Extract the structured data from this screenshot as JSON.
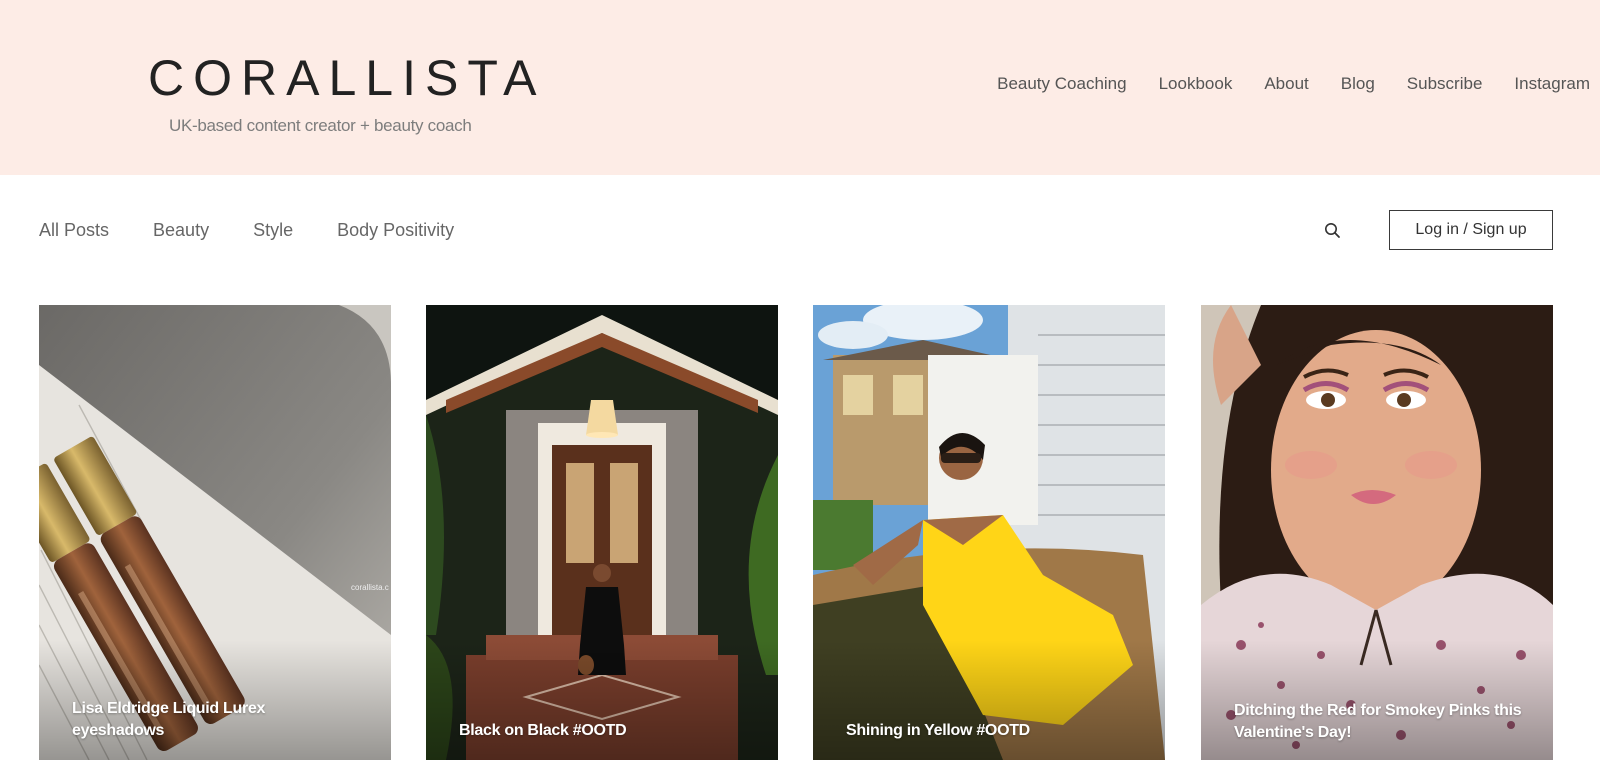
{
  "header": {
    "brand_name": "CORALLISTA",
    "tagline": "UK-based content creator + beauty coach",
    "nav": [
      "Beauty Coaching",
      "Lookbook",
      "About",
      "Blog",
      "Subscribe",
      "Instagram"
    ],
    "background_color": "#fdece6"
  },
  "blog_bar": {
    "categories": [
      "All Posts",
      "Beauty",
      "Style",
      "Body Positivity"
    ],
    "search_icon": "search-icon",
    "login_label": "Log in / Sign up"
  },
  "posts": [
    {
      "title": "Lisa Eldridge Liquid Lurex eyeshadows",
      "image": "lipgloss-tubes-photo",
      "watermark": "corallista.c"
    },
    {
      "title": "Black on Black #OOTD",
      "image": "woman-black-dress-porch-photo"
    },
    {
      "title": "Shining in Yellow #OOTD",
      "image": "woman-yellow-dress-photo"
    },
    {
      "title": "Ditching the Red for Smokey Pinks this Valentine's Day!",
      "image": "woman-pink-makeup-selfie-photo"
    }
  ]
}
